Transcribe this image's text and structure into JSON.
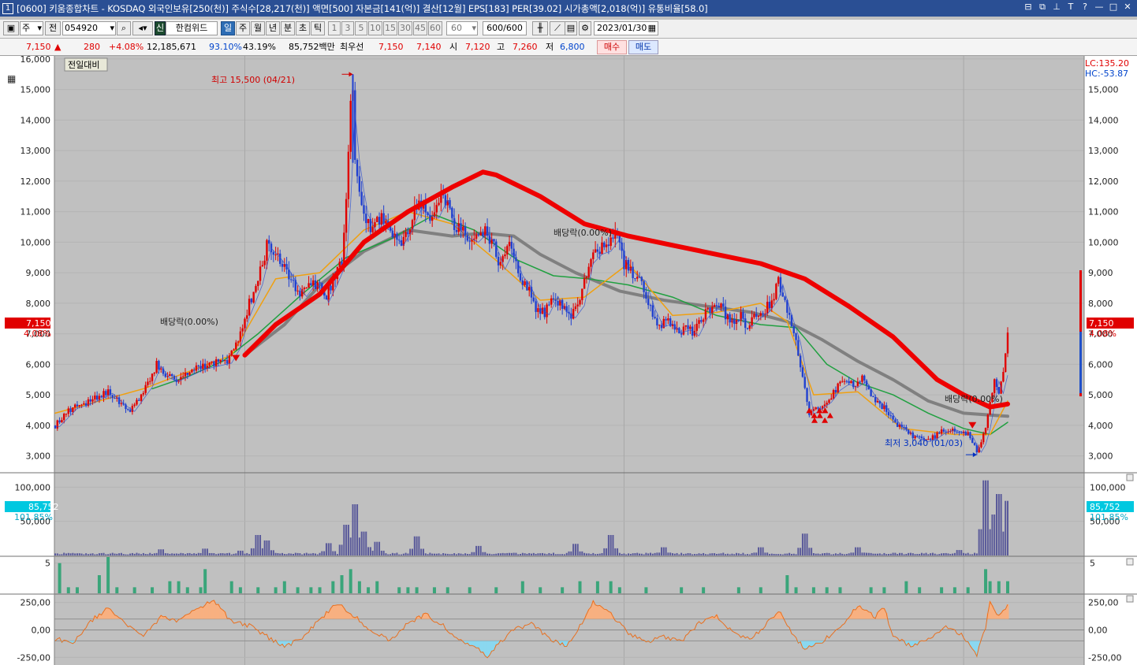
{
  "window": {
    "number": "1",
    "title": "[0600] 키움종합차트 - KOSDAQ 외국인보유[250(천)] 주식수[28,217(천)] 액면[500] 자본금[141(억)] 결산[12월] EPS[183] PER[39.02] 시가총액[2,018(억)] 유통비율[58.0]",
    "controls": [
      "⊟",
      "⧉",
      "⊥",
      "T",
      "?",
      "—",
      "□",
      "✕"
    ]
  },
  "toolbar": {
    "type_select": "주",
    "prev_label": "전",
    "code": "054920",
    "search_icon": "search-icon",
    "speaker_icon": "speaker-icon",
    "new_label": "신",
    "stock_name": "한컴위드",
    "periods": [
      "일",
      "주",
      "월",
      "년",
      "분",
      "초",
      "틱"
    ],
    "active_period": "일",
    "intervals": [
      "1",
      "3",
      "5",
      "10",
      "15",
      "30",
      "45",
      "60"
    ],
    "interval_value": "60",
    "count": "600",
    "count_total": "/600",
    "date": "2023/01/30"
  },
  "quote": {
    "price": "7,150",
    "change_arrow": "▲",
    "change": "280",
    "change_pct": "+4.08%",
    "volume": "12,185,671",
    "vol_ratio": "93.10%",
    "turnover": "43.19%",
    "amount": "85,752백만",
    "best_ask_label": "최우선",
    "ask": "7,150",
    "bid": "7,140",
    "open_label": "시",
    "open": "7,120",
    "high_label": "고",
    "high": "7,260",
    "low_label": "저",
    "low": "6,800",
    "buy_label": "매수",
    "sell_label": "매도"
  },
  "chart_data": {
    "type": "candlestick",
    "prev_compare_label": "전일대비",
    "lc_label": "LC:135.20",
    "hc_label": "HC:-53.87",
    "price_axis": [
      "16,000",
      "15,000",
      "14,000",
      "13,000",
      "12,000",
      "11,000",
      "10,000",
      "9,000",
      "8,000",
      "7,000",
      "6,000",
      "5,000",
      "4,000",
      "3,000"
    ],
    "price_ticks": [
      16000,
      15000,
      14000,
      13000,
      12000,
      11000,
      10000,
      9000,
      8000,
      7000,
      6000,
      5000,
      4000,
      3000
    ],
    "ylim": [
      2500,
      16100
    ],
    "current_price": "7,150",
    "current_pct": "4.08%",
    "high_annotation": "최고 15,500 (04/21)",
    "low_annotation": "최저 3,040 (01/03)",
    "dividend_labels": [
      "배당락(0.00%)",
      "배당락(0.00%)",
      "배당락(0.00%)"
    ],
    "price_path": [
      [
        0,
        4000
      ],
      [
        4,
        4600
      ],
      [
        8,
        4800
      ],
      [
        12,
        5100
      ],
      [
        15,
        4700
      ],
      [
        17,
        4500
      ],
      [
        19,
        4900
      ],
      [
        21,
        5300
      ],
      [
        23,
        6000
      ],
      [
        25,
        5600
      ],
      [
        27,
        5500
      ],
      [
        30,
        5700
      ],
      [
        33,
        5900
      ],
      [
        36,
        6000
      ],
      [
        39,
        6100
      ],
      [
        41,
        6600
      ],
      [
        43,
        7600
      ],
      [
        46,
        8700
      ],
      [
        48,
        9900
      ],
      [
        50,
        9600
      ],
      [
        52,
        9200
      ],
      [
        54,
        8700
      ],
      [
        56,
        8300
      ],
      [
        58,
        8700
      ],
      [
        60,
        8500
      ],
      [
        61,
        8100
      ],
      [
        63,
        8700
      ],
      [
        65,
        9400
      ],
      [
        66,
        11400
      ],
      [
        67,
        14400
      ],
      [
        67.5,
        15300
      ],
      [
        68,
        12800
      ],
      [
        69,
        11800
      ],
      [
        70,
        11000
      ],
      [
        72,
        10400
      ],
      [
        74,
        10900
      ],
      [
        76,
        10300
      ],
      [
        78,
        10000
      ],
      [
        80,
        10500
      ],
      [
        82,
        11200
      ],
      [
        84,
        11000
      ],
      [
        86,
        10900
      ],
      [
        88,
        11500
      ],
      [
        90,
        10700
      ],
      [
        92,
        10300
      ],
      [
        95,
        10100
      ],
      [
        97,
        10400
      ],
      [
        99,
        10000
      ],
      [
        101,
        9200
      ],
      [
        103,
        9800
      ],
      [
        105,
        9000
      ],
      [
        107,
        8600
      ],
      [
        109,
        7900
      ],
      [
        111,
        7700
      ],
      [
        113,
        8300
      ],
      [
        115,
        7800
      ],
      [
        117,
        7600
      ],
      [
        119,
        8000
      ],
      [
        121,
        9400
      ],
      [
        123,
        9700
      ],
      [
        125,
        9800
      ],
      [
        127,
        10200
      ],
      [
        129,
        9300
      ],
      [
        131,
        9000
      ],
      [
        133,
        8800
      ],
      [
        135,
        7900
      ],
      [
        137,
        7300
      ],
      [
        139,
        7400
      ],
      [
        141,
        7100
      ],
      [
        143,
        7200
      ],
      [
        145,
        7000
      ],
      [
        147,
        7600
      ],
      [
        149,
        7900
      ],
      [
        151,
        7800
      ],
      [
        153,
        7400
      ],
      [
        155,
        7600
      ],
      [
        157,
        7300
      ],
      [
        159,
        7600
      ],
      [
        161,
        7800
      ],
      [
        163,
        8200
      ],
      [
        164,
        8700
      ],
      [
        166,
        7700
      ],
      [
        168,
        6800
      ],
      [
        170,
        5300
      ],
      [
        171,
        4400
      ],
      [
        173,
        4600
      ],
      [
        175,
        4800
      ],
      [
        177,
        5200
      ],
      [
        179,
        5400
      ],
      [
        181,
        5300
      ],
      [
        183,
        5500
      ],
      [
        185,
        5000
      ],
      [
        187,
        4700
      ],
      [
        189,
        4400
      ],
      [
        191,
        4000
      ],
      [
        193,
        3800
      ],
      [
        195,
        3600
      ],
      [
        197,
        3500
      ],
      [
        199,
        3600
      ],
      [
        201,
        3800
      ],
      [
        203,
        3900
      ],
      [
        205,
        3800
      ],
      [
        207,
        3700
      ],
      [
        208,
        3400
      ],
      [
        209,
        3150
      ],
      [
        210,
        3400
      ],
      [
        211,
        3900
      ],
      [
        212,
        4700
      ],
      [
        213,
        5500
      ],
      [
        214,
        5100
      ],
      [
        215,
        5700
      ],
      [
        216,
        7150
      ]
    ],
    "ma_red": [
      [
        43,
        6300
      ],
      [
        50,
        7300
      ],
      [
        60,
        8300
      ],
      [
        70,
        10000
      ],
      [
        80,
        11000
      ],
      [
        90,
        11800
      ],
      [
        97,
        12300
      ],
      [
        100,
        12200
      ],
      [
        110,
        11500
      ],
      [
        120,
        10600
      ],
      [
        130,
        10200
      ],
      [
        140,
        9900
      ],
      [
        150,
        9600
      ],
      [
        160,
        9300
      ],
      [
        170,
        8800
      ],
      [
        180,
        7900
      ],
      [
        190,
        6900
      ],
      [
        200,
        5500
      ],
      [
        206,
        5000
      ],
      [
        212,
        4600
      ],
      [
        216,
        4700
      ]
    ],
    "ma_gray": [
      [
        43,
        6300
      ],
      [
        52,
        7300
      ],
      [
        60,
        8600
      ],
      [
        70,
        9700
      ],
      [
        80,
        10400
      ],
      [
        90,
        10200
      ],
      [
        97,
        10300
      ],
      [
        104,
        10200
      ],
      [
        110,
        9600
      ],
      [
        118,
        9000
      ],
      [
        128,
        8400
      ],
      [
        138,
        8100
      ],
      [
        148,
        7900
      ],
      [
        158,
        7700
      ],
      [
        166,
        7400
      ],
      [
        174,
        6800
      ],
      [
        182,
        6100
      ],
      [
        190,
        5500
      ],
      [
        198,
        4800
      ],
      [
        206,
        4400
      ],
      [
        216,
        4300
      ]
    ],
    "ma_green": [
      [
        22,
        5200
      ],
      [
        30,
        5600
      ],
      [
        38,
        6100
      ],
      [
        46,
        7000
      ],
      [
        56,
        8300
      ],
      [
        66,
        9500
      ],
      [
        76,
        10100
      ],
      [
        86,
        10900
      ],
      [
        95,
        10400
      ],
      [
        105,
        9400
      ],
      [
        113,
        8900
      ],
      [
        121,
        8800
      ],
      [
        130,
        8600
      ],
      [
        140,
        8200
      ],
      [
        150,
        7600
      ],
      [
        160,
        7300
      ],
      [
        168,
        7200
      ],
      [
        175,
        6000
      ],
      [
        182,
        5400
      ],
      [
        190,
        5000
      ],
      [
        198,
        4400
      ],
      [
        206,
        3900
      ],
      [
        212,
        3700
      ],
      [
        216,
        4100
      ]
    ],
    "ma_orange": [
      [
        0,
        4400
      ],
      [
        20,
        5200
      ],
      [
        40,
        6300
      ],
      [
        50,
        8800
      ],
      [
        60,
        9000
      ],
      [
        70,
        10400
      ],
      [
        80,
        11000
      ],
      [
        90,
        10600
      ],
      [
        100,
        9400
      ],
      [
        110,
        8100
      ],
      [
        120,
        8200
      ],
      [
        130,
        9300
      ],
      [
        140,
        7600
      ],
      [
        150,
        7700
      ],
      [
        160,
        8000
      ],
      [
        166,
        7400
      ],
      [
        172,
        5000
      ],
      [
        182,
        5100
      ],
      [
        192,
        3900
      ],
      [
        204,
        3700
      ],
      [
        212,
        3700
      ],
      [
        216,
        4800
      ]
    ],
    "volume_axis": [
      "100,000",
      "50,000"
    ],
    "volume_ticks": [
      100000,
      50000
    ],
    "volume_max": 120000,
    "volume_label": "85,752",
    "volume_pct": "101.85%",
    "volume_spikes": [
      [
        0,
        3000
      ],
      [
        24,
        9000
      ],
      [
        34,
        10000
      ],
      [
        42,
        7000
      ],
      [
        46,
        30000
      ],
      [
        48,
        22000
      ],
      [
        62,
        18000
      ],
      [
        66,
        45000
      ],
      [
        68,
        75000
      ],
      [
        70,
        35000
      ],
      [
        73,
        20000
      ],
      [
        82,
        28000
      ],
      [
        96,
        14000
      ],
      [
        118,
        17000
      ],
      [
        126,
        30000
      ],
      [
        138,
        12000
      ],
      [
        160,
        12000
      ],
      [
        170,
        32000
      ],
      [
        182,
        12000
      ],
      [
        205,
        8000
      ],
      [
        211,
        110000
      ],
      [
        213,
        60000
      ],
      [
        214,
        90000
      ],
      [
        215,
        35000
      ],
      [
        216,
        80000
      ]
    ],
    "signal_axis": [
      "5"
    ],
    "signal_bars": [
      [
        1,
        5
      ],
      [
        3,
        1
      ],
      [
        5,
        1
      ],
      [
        10,
        3
      ],
      [
        12,
        6
      ],
      [
        14,
        1
      ],
      [
        18,
        1
      ],
      [
        22,
        1
      ],
      [
        26,
        2
      ],
      [
        28,
        2
      ],
      [
        30,
        1
      ],
      [
        33,
        1
      ],
      [
        34,
        4
      ],
      [
        40,
        2
      ],
      [
        42,
        1
      ],
      [
        46,
        1
      ],
      [
        50,
        1
      ],
      [
        52,
        2
      ],
      [
        55,
        1
      ],
      [
        58,
        1
      ],
      [
        60,
        1
      ],
      [
        63,
        2
      ],
      [
        65,
        3
      ],
      [
        67,
        4
      ],
      [
        69,
        2
      ],
      [
        71,
        1
      ],
      [
        73,
        2
      ],
      [
        78,
        1
      ],
      [
        80,
        1
      ],
      [
        82,
        1
      ],
      [
        86,
        1
      ],
      [
        89,
        1
      ],
      [
        94,
        1
      ],
      [
        100,
        1
      ],
      [
        106,
        2
      ],
      [
        110,
        1
      ],
      [
        115,
        1
      ],
      [
        119,
        2
      ],
      [
        123,
        2
      ],
      [
        126,
        2
      ],
      [
        128,
        1
      ],
      [
        134,
        1
      ],
      [
        142,
        1
      ],
      [
        147,
        1
      ],
      [
        155,
        1
      ],
      [
        160,
        1
      ],
      [
        166,
        3
      ],
      [
        168,
        1
      ],
      [
        172,
        1
      ],
      [
        175,
        1
      ],
      [
        178,
        1
      ],
      [
        185,
        1
      ],
      [
        188,
        1
      ],
      [
        193,
        2
      ],
      [
        196,
        1
      ],
      [
        201,
        1
      ],
      [
        204,
        1
      ],
      [
        207,
        1
      ],
      [
        211,
        4
      ],
      [
        212,
        2
      ],
      [
        214,
        2
      ],
      [
        216,
        2
      ]
    ],
    "cci_axis": [
      "250,00",
      "0,00",
      "-250,00"
    ],
    "cci_ticks": [
      250,
      0,
      -250
    ],
    "cci_path": [
      [
        0,
        -80
      ],
      [
        4,
        -120
      ],
      [
        8,
        80
      ],
      [
        12,
        200
      ],
      [
        16,
        60
      ],
      [
        20,
        -60
      ],
      [
        24,
        120
      ],
      [
        28,
        80
      ],
      [
        32,
        200
      ],
      [
        36,
        260
      ],
      [
        40,
        80
      ],
      [
        44,
        40
      ],
      [
        48,
        -60
      ],
      [
        52,
        -150
      ],
      [
        56,
        -80
      ],
      [
        60,
        100
      ],
      [
        64,
        240
      ],
      [
        68,
        120
      ],
      [
        72,
        -20
      ],
      [
        76,
        -90
      ],
      [
        80,
        60
      ],
      [
        84,
        140
      ],
      [
        88,
        40
      ],
      [
        92,
        -100
      ],
      [
        96,
        -180
      ],
      [
        98,
        -240
      ],
      [
        100,
        -150
      ],
      [
        104,
        0
      ],
      [
        108,
        60
      ],
      [
        112,
        -80
      ],
      [
        116,
        -150
      ],
      [
        120,
        100
      ],
      [
        122,
        260
      ],
      [
        126,
        140
      ],
      [
        130,
        -30
      ],
      [
        134,
        -120
      ],
      [
        138,
        -60
      ],
      [
        142,
        -100
      ],
      [
        146,
        60
      ],
      [
        150,
        120
      ],
      [
        154,
        -40
      ],
      [
        158,
        -70
      ],
      [
        162,
        80
      ],
      [
        164,
        180
      ],
      [
        168,
        -80
      ],
      [
        170,
        -170
      ],
      [
        174,
        -100
      ],
      [
        178,
        20
      ],
      [
        182,
        220
      ],
      [
        186,
        120
      ],
      [
        188,
        200
      ],
      [
        190,
        -60
      ],
      [
        194,
        -150
      ],
      [
        198,
        -90
      ],
      [
        202,
        40
      ],
      [
        206,
        -60
      ],
      [
        209,
        -230
      ],
      [
        211,
        20
      ],
      [
        212,
        270
      ],
      [
        214,
        120
      ],
      [
        216,
        220
      ]
    ],
    "date_separators": [
      43,
      129,
      206
    ],
    "index_count": 216
  }
}
